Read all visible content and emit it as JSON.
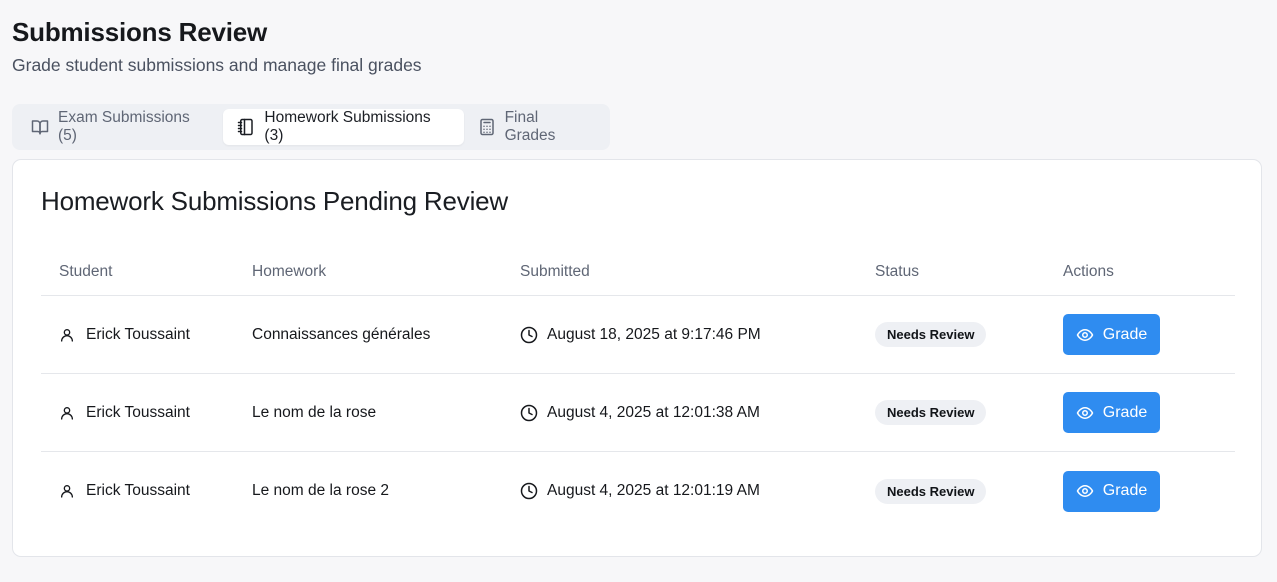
{
  "header": {
    "title": "Submissions Review",
    "subtitle": "Grade student submissions and manage final grades"
  },
  "tabs": [
    {
      "label": "Exam Submissions (5)",
      "icon": "book-open-icon",
      "active": false
    },
    {
      "label": "Homework Submissions (3)",
      "icon": "notebook-icon",
      "active": true
    },
    {
      "label": "Final Grades",
      "icon": "calculator-icon",
      "active": false
    }
  ],
  "card": {
    "title": "Homework Submissions Pending Review",
    "columns": [
      "Student",
      "Homework",
      "Submitted",
      "Status",
      "Actions"
    ],
    "rows": [
      {
        "student": "Erick Toussaint",
        "homework": "Connaissances générales",
        "submitted": "August 18, 2025 at 9:17:46 PM",
        "status": "Needs Review",
        "action": "Grade"
      },
      {
        "student": "Erick Toussaint",
        "homework": "Le nom de la rose",
        "submitted": "August 4, 2025 at 12:01:38 AM",
        "status": "Needs Review",
        "action": "Grade"
      },
      {
        "student": "Erick Toussaint",
        "homework": "Le nom de la rose 2",
        "submitted": "August 4, 2025 at 12:01:19 AM",
        "status": "Needs Review",
        "action": "Grade"
      }
    ]
  },
  "colors": {
    "accent": "#2f8cf0",
    "background": "#f7f7f9",
    "badge_bg": "#eef0f4"
  }
}
